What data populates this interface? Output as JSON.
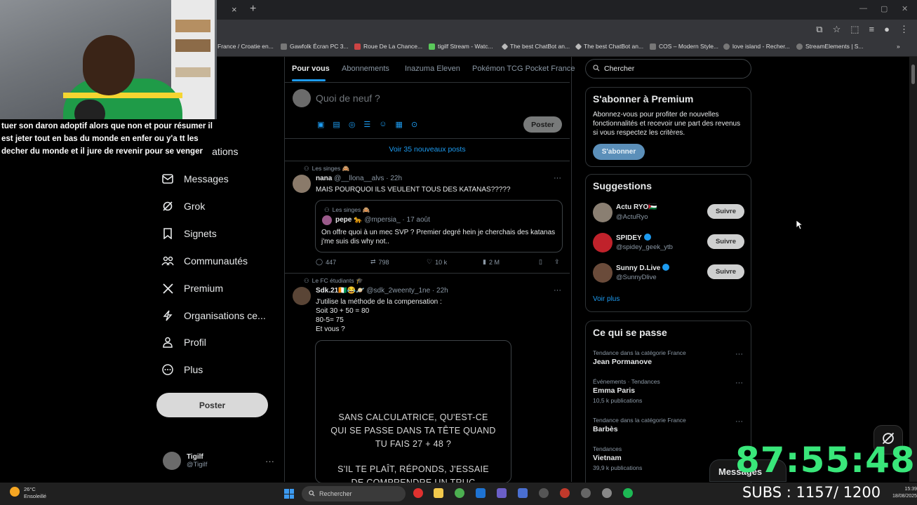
{
  "browser": {
    "tab_close": "×",
    "tab_new": "+",
    "bookmarks": [
      "France / Croatie en...",
      "Gawfolk Écran PC 3...",
      "Roue De La Chance...",
      "tigilf Stream - Watc...",
      "The best ChatBot an...",
      "The best ChatBot an...",
      "COS – Modern Style...",
      "love island - Recher...",
      "StreamElements | S..."
    ],
    "bookmarks_more": "»"
  },
  "webcam": {
    "caption_lines": [
      "tuer son daron adoptif alors que non et pour résumer il",
      "est jeter tout en bas du monde en enfer ou y'a tt les",
      "decher du monde et il jure de revenir pour se venger"
    ],
    "notif_partial": "ifications"
  },
  "nav": {
    "items": [
      {
        "label": "Messages",
        "icon": "mail-icon"
      },
      {
        "label": "Grok",
        "icon": "grok-icon"
      },
      {
        "label": "Signets",
        "icon": "bookmark-icon"
      },
      {
        "label": "Communautés",
        "icon": "communities-icon"
      },
      {
        "label": "Premium",
        "icon": "x-logo-icon"
      },
      {
        "label": "Organisations ce...",
        "icon": "lightning-icon"
      },
      {
        "label": "Profil",
        "icon": "person-icon"
      },
      {
        "label": "Plus",
        "icon": "more-circle-icon"
      }
    ],
    "post_button": "Poster",
    "account": {
      "name": "Tigilf",
      "handle": "@Tigilf",
      "more": "···"
    }
  },
  "feed": {
    "tabs": [
      "Pour vous",
      "Abonnements",
      "Inazuma Eleven",
      "Pokémon TCG Pocket France"
    ],
    "compose_placeholder": "Quoi de neuf ?",
    "compose_post": "Poster",
    "new_posts": "Voir 35 nouveaux posts",
    "posts": [
      {
        "context": "Les singes 🙈",
        "name": "nana",
        "handle": "@__llona__alvs · 22h",
        "text": "MAIS POURQUOI ILS VEULENT TOUS DES KATANAS?????",
        "quote": {
          "context": "Les singes 🙈",
          "name": "pepe 🐆",
          "handle": "@mpersia_ · 17 août",
          "text": "On offre quoi à un mec SVP ? Premier degré hein je cherchais des katanas j'me suis dis why not.."
        },
        "replies": "447",
        "reposts": "798",
        "likes": "10 k",
        "views": "2 M"
      },
      {
        "context": "Le FC étudiants 🎓",
        "name": "Sdk.21🇨🇮😂🪐",
        "handle": "@sdk_2weenty_1ne · 22h",
        "text_lines": [
          "J'utilise la méthode de la compensation :",
          "Soit 30 + 50 = 80",
          "80-5= 75",
          "Et vous ?"
        ],
        "media_lines": [
          "SANS CALCULATRICE, QU'EST-CE",
          "QUI SE PASSE DANS TA TÊTE QUAND",
          "TU FAIS 27 + 48 ?",
          "S'IL TE PLAÎT, RÉPONDS, J'ESSAIE",
          "DE COMPRENDRE UN TRUC"
        ]
      }
    ],
    "more": "···"
  },
  "sidebar": {
    "search_placeholder": "Chercher",
    "premium": {
      "title": "S'abonner à Premium",
      "text": "Abonnez-vous pour profiter de nouvelles fonctionnalités et recevoir une part des revenus si vous respectez les critères.",
      "button": "S'abonner"
    },
    "suggestions": {
      "title": "Suggestions",
      "users": [
        {
          "name": "Actu RYO🇵🇸",
          "handle": "@ActuRyo",
          "verified": false,
          "button": "Suivre"
        },
        {
          "name": "SPIDEY",
          "handle": "@spidey_geek_ytb",
          "verified": true,
          "button": "Suivre"
        },
        {
          "name": "Sunny D.Live",
          "handle": "@SunnyDlive",
          "verified": true,
          "button": "Suivre"
        }
      ],
      "more": "Voir plus"
    },
    "trends": {
      "title": "Ce qui se passe",
      "items": [
        {
          "category": "Tendance dans la catégorie France",
          "name": "Jean Pormanove",
          "count": ""
        },
        {
          "category": "Événements · Tendances",
          "name": "Emma Paris",
          "count": "10,5 k publications"
        },
        {
          "category": "Tendance dans la catégorie France",
          "name": "Barbès",
          "count": ""
        },
        {
          "category": "Tendances",
          "name": "Vietnam",
          "count": "39,9 k publications"
        }
      ]
    }
  },
  "overlay": {
    "messages_drawer": "Messages",
    "timer": "87:55:48",
    "subs": "SUBS : 1157/ 1200"
  },
  "taskbar": {
    "temp": "26°C",
    "weather": "Ensoleillé",
    "search": "Rechercher",
    "time": "15:39",
    "date": "18/08/2025"
  }
}
